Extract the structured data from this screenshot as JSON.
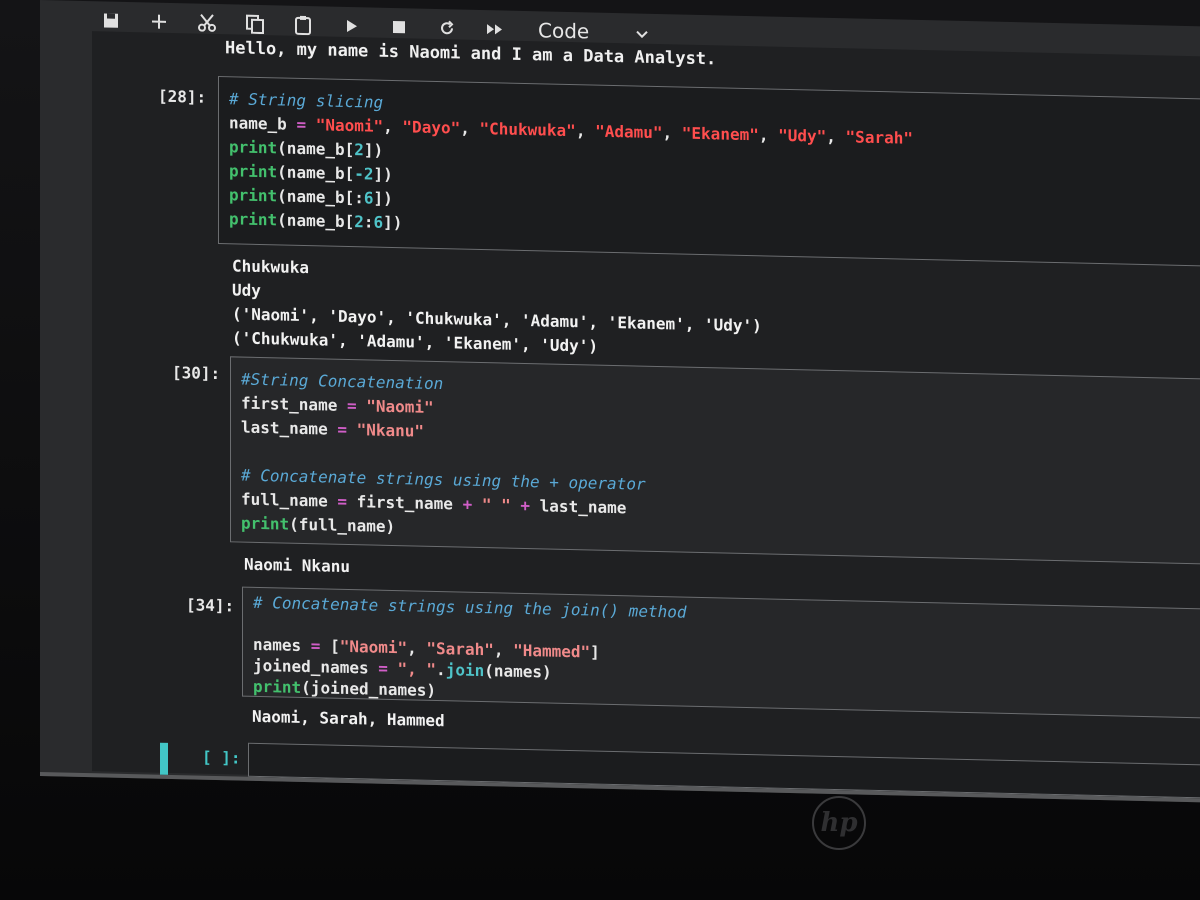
{
  "toolbar": {
    "cell_type": "Code"
  },
  "top_output": "Hello, my name is Naomi and I am a Data Analyst.",
  "cells": [
    {
      "prompt": "[28]:",
      "lines": [
        [
          {
            "t": "# String slicing",
            "c": "cm"
          }
        ],
        [
          {
            "t": "name_b ",
            "c": "br"
          },
          {
            "t": "=",
            "c": "op"
          },
          {
            "t": " ",
            "c": "br"
          },
          {
            "t": "\"Naomi\"",
            "c": "str"
          },
          {
            "t": ", ",
            "c": "br"
          },
          {
            "t": "\"Dayo\"",
            "c": "str"
          },
          {
            "t": ", ",
            "c": "br"
          },
          {
            "t": "\"Chukwuka\"",
            "c": "str"
          },
          {
            "t": ", ",
            "c": "br"
          },
          {
            "t": "\"Adamu\"",
            "c": "str"
          },
          {
            "t": ", ",
            "c": "br"
          },
          {
            "t": "\"Ekanem\"",
            "c": "str"
          },
          {
            "t": ", ",
            "c": "br"
          },
          {
            "t": "\"Udy\"",
            "c": "str"
          },
          {
            "t": ", ",
            "c": "br"
          },
          {
            "t": "\"Sarah\"",
            "c": "str"
          }
        ],
        [
          {
            "t": "print",
            "c": "fn"
          },
          {
            "t": "(name_b[",
            "c": "br"
          },
          {
            "t": "2",
            "c": "num"
          },
          {
            "t": "])",
            "c": "br"
          }
        ],
        [
          {
            "t": "print",
            "c": "fn"
          },
          {
            "t": "(name_b[",
            "c": "br"
          },
          {
            "t": "-2",
            "c": "num"
          },
          {
            "t": "])",
            "c": "br"
          }
        ],
        [
          {
            "t": "print",
            "c": "fn"
          },
          {
            "t": "(name_b[:",
            "c": "br"
          },
          {
            "t": "6",
            "c": "num"
          },
          {
            "t": "])",
            "c": "br"
          }
        ],
        [
          {
            "t": "print",
            "c": "fn"
          },
          {
            "t": "(name_b[",
            "c": "br"
          },
          {
            "t": "2",
            "c": "num"
          },
          {
            "t": ":",
            "c": "br"
          },
          {
            "t": "6",
            "c": "num"
          },
          {
            "t": "])",
            "c": "br"
          }
        ]
      ],
      "output": "Chukwuka\nUdy\n('Naomi', 'Dayo', 'Chukwuka', 'Adamu', 'Ekanem', 'Udy')\n('Chukwuka', 'Adamu', 'Ekanem', 'Udy')"
    },
    {
      "prompt": "[30]:",
      "lines": [
        [
          {
            "t": "#String Concatenation",
            "c": "cm"
          }
        ],
        [
          {
            "t": "first_name ",
            "c": "br"
          },
          {
            "t": "=",
            "c": "op"
          },
          {
            "t": " ",
            "c": "br"
          },
          {
            "t": "\"Naomi\"",
            "c": "strp"
          }
        ],
        [
          {
            "t": "last_name ",
            "c": "br"
          },
          {
            "t": "=",
            "c": "op"
          },
          {
            "t": " ",
            "c": "br"
          },
          {
            "t": "\"Nkanu\"",
            "c": "strp"
          }
        ],
        [
          {
            "t": " ",
            "c": "br"
          }
        ],
        [
          {
            "t": "# Concatenate strings using the + operator",
            "c": "cm"
          }
        ],
        [
          {
            "t": "full_name ",
            "c": "br"
          },
          {
            "t": "=",
            "c": "op"
          },
          {
            "t": " first_name ",
            "c": "br"
          },
          {
            "t": "+",
            "c": "op"
          },
          {
            "t": " ",
            "c": "br"
          },
          {
            "t": "\" \"",
            "c": "strp"
          },
          {
            "t": " ",
            "c": "br"
          },
          {
            "t": "+",
            "c": "op"
          },
          {
            "t": " last_name",
            "c": "br"
          }
        ],
        [
          {
            "t": "print",
            "c": "fn"
          },
          {
            "t": "(full_name)",
            "c": "br"
          }
        ]
      ],
      "output": "Naomi Nkanu"
    },
    {
      "prompt": "[34]:",
      "lines": [
        [
          {
            "t": "# Concatenate strings using the join() method",
            "c": "cm"
          }
        ],
        [
          {
            "t": " ",
            "c": "br"
          }
        ],
        [
          {
            "t": "names ",
            "c": "br"
          },
          {
            "t": "=",
            "c": "op"
          },
          {
            "t": " [",
            "c": "br"
          },
          {
            "t": "\"Naomi\"",
            "c": "strp"
          },
          {
            "t": ", ",
            "c": "br"
          },
          {
            "t": "\"Sarah\"",
            "c": "strp"
          },
          {
            "t": ", ",
            "c": "br"
          },
          {
            "t": "\"Hammed\"",
            "c": "strp"
          },
          {
            "t": "]",
            "c": "br"
          }
        ],
        [
          {
            "t": "joined_names ",
            "c": "br"
          },
          {
            "t": "=",
            "c": "op"
          },
          {
            "t": " ",
            "c": "br"
          },
          {
            "t": "\", \"",
            "c": "strp"
          },
          {
            "t": ".",
            "c": "br"
          },
          {
            "t": "join",
            "c": "num"
          },
          {
            "t": "(names)",
            "c": "br"
          }
        ],
        [
          {
            "t": "print",
            "c": "fn"
          },
          {
            "t": "(joined_names)",
            "c": "br"
          }
        ]
      ],
      "output": "Naomi, Sarah, Hammed"
    }
  ],
  "empty_prompt": "[ ]:",
  "brand_logo": "hp",
  "icons": [
    "save-icon",
    "plus-icon",
    "scissors-icon",
    "copy-icon",
    "paste-icon",
    "run-icon",
    "stop-icon",
    "restart-icon",
    "fast-forward-icon",
    "chevron-down-icon"
  ]
}
